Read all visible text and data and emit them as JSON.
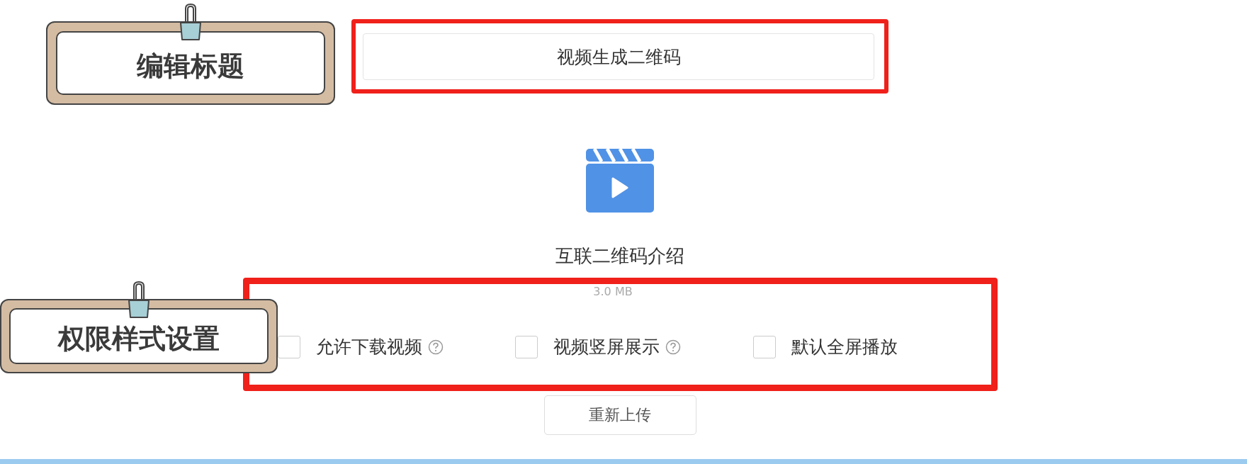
{
  "annotations": [
    {
      "label": "编辑标题"
    },
    {
      "label": "权限样式设置"
    }
  ],
  "title_field": {
    "value": "视频生成二维码"
  },
  "file": {
    "name": "互联二维码介绍",
    "size": "3.0 MB"
  },
  "options": [
    {
      "label": "允许下载视频",
      "checked": false,
      "help": true
    },
    {
      "label": "视频竖屏展示",
      "checked": false,
      "help": true
    },
    {
      "label": "默认全屏播放",
      "checked": false,
      "help": false
    }
  ],
  "reupload_button": "重新上传"
}
